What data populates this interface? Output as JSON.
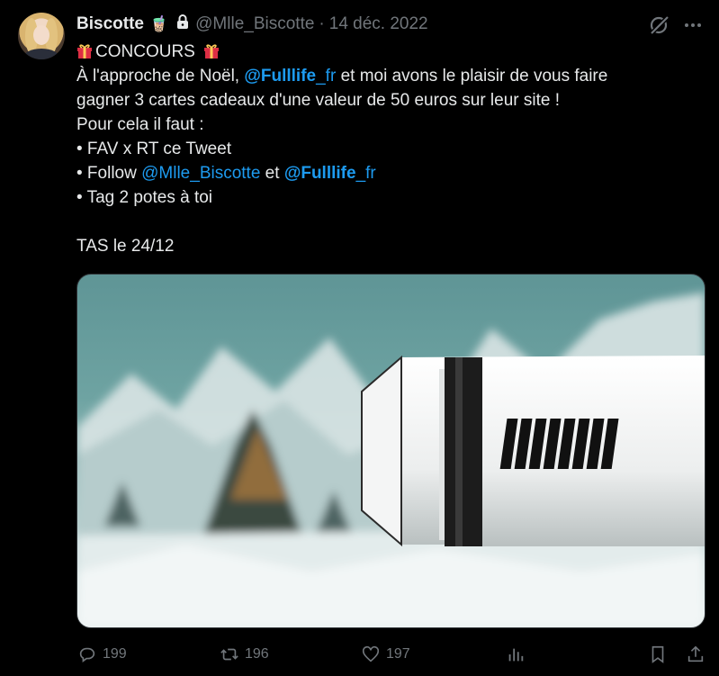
{
  "tweet": {
    "display_name": "Biscotte",
    "name_emoji": "🧋",
    "handle": "@Mlle_Biscotte",
    "separator": "·",
    "date": "14 déc. 2022",
    "lines": {
      "l1": "CONCOURS",
      "l2_pre": "À l'approche de Noël, ",
      "l2_mention": "@Fulllife_fr",
      "l2_post": " et moi avons le plaisir de vous faire",
      "l3": "gagner 3 cartes cadeaux d'une valeur de 50 euros sur leur site !",
      "l4": "Pour cela il faut :",
      "l5": "• FAV x RT ce Tweet",
      "l6_pre": "• Follow ",
      "l6_mention1": "@Mlle_Biscotte",
      "l6_mid": " et ",
      "l6_mention2": "@Fulllife_fr",
      "l7": "• Tag 2 potes à toi",
      "l8": "TAS le 24/12"
    }
  },
  "actions": {
    "replies": "199",
    "retweets": "196",
    "likes": "197"
  },
  "icons": {
    "gift": "gift-icon",
    "lock": "lock-icon",
    "grok": "grok-icon",
    "more": "more-icon",
    "reply": "reply-icon",
    "retweet": "retweet-icon",
    "like": "heart-icon",
    "views": "analytics-icon",
    "bookmark": "bookmark-icon",
    "share": "share-icon"
  },
  "colors": {
    "background": "#000000",
    "text": "#e7e9ea",
    "muted": "#71767b",
    "link": "#1d9bf0"
  }
}
